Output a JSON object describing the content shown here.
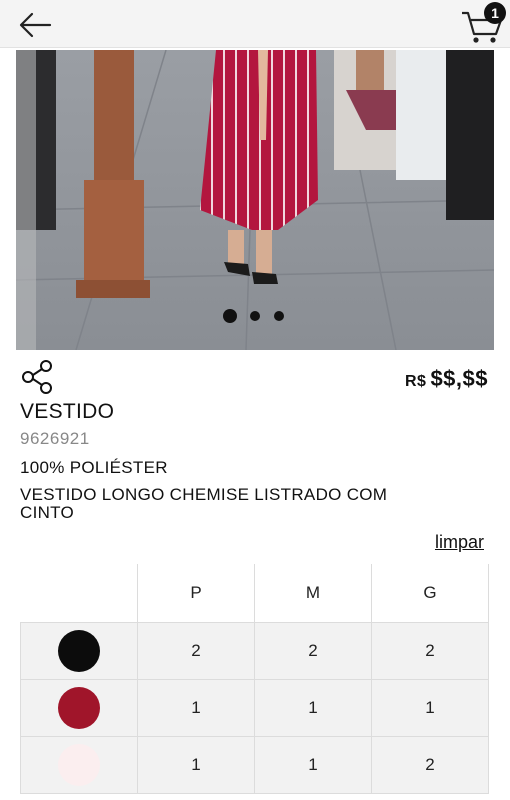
{
  "header": {
    "back_icon": "arrow-left-icon",
    "cart_icon": "shopping-cart-icon",
    "cart_count": "1"
  },
  "gallery": {
    "image_description_icon": "product-photo",
    "slide_count": 3,
    "active_slide": 1
  },
  "product": {
    "share_icon": "share-icon",
    "currency": "R$",
    "price": "$$,$$",
    "name": "VESTIDO",
    "sku": "9626921",
    "material": "100% POLIÉSTER",
    "description": "VESTIDO LONGO CHEMISE LISTRADO COM CINTO"
  },
  "grid": {
    "clear_label": "limpar",
    "sizes": [
      "P",
      "M",
      "G"
    ],
    "colors": [
      {
        "hex": "#0c0c0c",
        "quantities": [
          "2",
          "2",
          "2"
        ]
      },
      {
        "hex": "#a0152a",
        "quantities": [
          "1",
          "1",
          "1"
        ]
      },
      {
        "hex": "#fbeeef",
        "quantities": [
          "1",
          "1",
          "2"
        ]
      }
    ]
  }
}
